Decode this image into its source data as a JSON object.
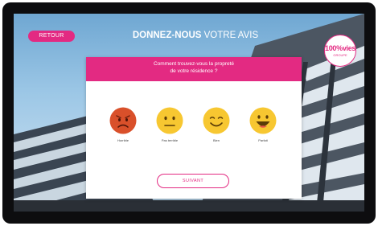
{
  "header": {
    "back_label": "RETOUR",
    "title_bold": "DONNEZ-NOUS",
    "title_rest": " VOTRE AVIS"
  },
  "logo": {
    "text": "100%vies",
    "sub": "GROUPE"
  },
  "card": {
    "question_line1": "Comment trouvez-vous la propreté",
    "question_line2": "de votre résidence ?",
    "options": [
      {
        "label": "Horrible",
        "icon": "angry-face-icon",
        "color": "#d9502a"
      },
      {
        "label": "Pas terrible",
        "icon": "neutral-face-icon",
        "color": "#f7c731"
      },
      {
        "label": "Bien",
        "icon": "smiling-face-icon",
        "color": "#f7c731"
      },
      {
        "label": "Parfait",
        "icon": "grinning-face-icon",
        "color": "#f7c731"
      }
    ],
    "next_label": "SUIVANT"
  },
  "colors": {
    "accent": "#e32a82",
    "bezel": "#0d0d0f"
  }
}
